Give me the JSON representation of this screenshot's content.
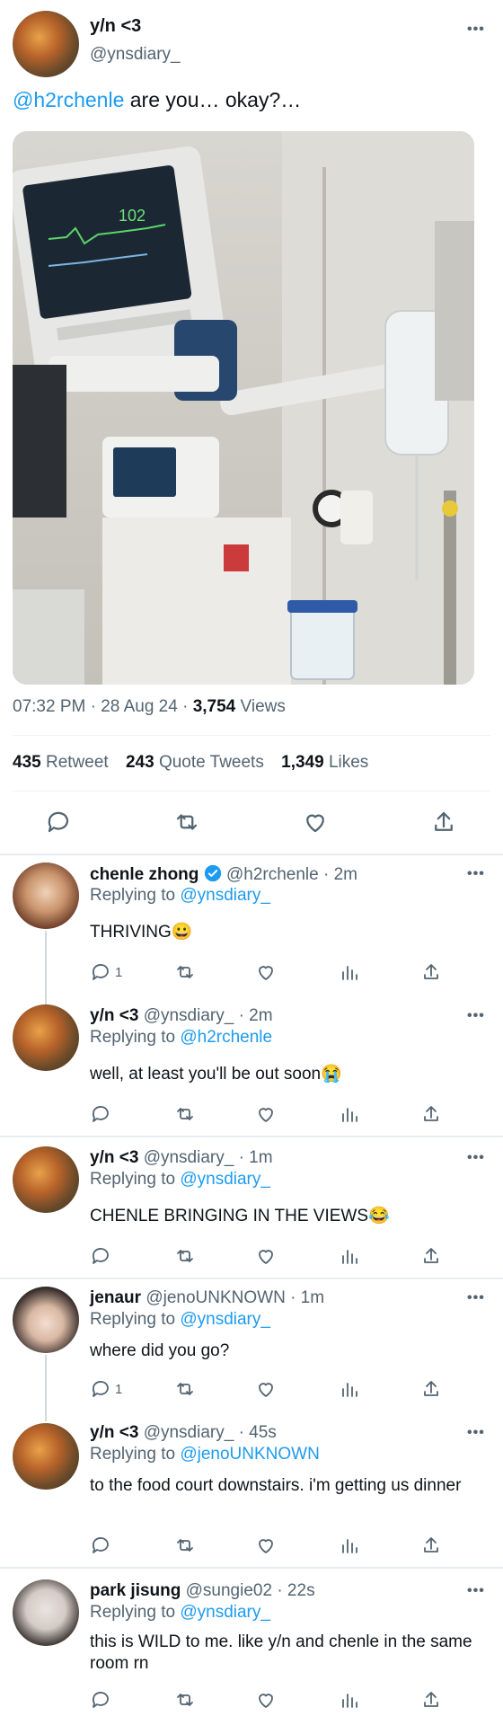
{
  "main_tweet": {
    "display_name": "y/n <3",
    "handle": "@ynsdiary_",
    "mention": "@h2rchenle",
    "text": " are you… okay?…",
    "time": "07:32 PM · 28 Aug 24 · ",
    "views_count": "3,754",
    "views_label": " Views",
    "retweets_count": "435",
    "retweets_label": " Retweet",
    "quotes_count": "243",
    "quotes_label": " Quote Tweets",
    "likes_count": "1,349",
    "likes_label": " Likes"
  },
  "replies": [
    {
      "display_name": "chenle zhong",
      "verified": true,
      "handle_time": "@h2rchenle · 2m",
      "replying_prefix": "Replying to ",
      "replying_to": "@ynsdiary_",
      "text": "THRIVING😀",
      "reply_count": "1"
    },
    {
      "display_name": "y/n <3",
      "handle_time": "@ynsdiary_ · 2m",
      "replying_prefix": "Replying to ",
      "replying_to": "@h2rchenle",
      "text": "well, at least you'll be out soon😭",
      "reply_count": ""
    },
    {
      "display_name": "y/n <3",
      "handle_time": "@ynsdiary_ · 1m",
      "replying_prefix": "Replying to ",
      "replying_to": "@ynsdiary_",
      "text": "CHENLE BRINGING IN THE VIEWS😂",
      "reply_count": ""
    },
    {
      "display_name": "jenaur",
      "handle_time": "@jenoUNKNOWN · 1m",
      "replying_prefix": "Replying to ",
      "replying_to": "@ynsdiary_",
      "text": "where did you go?",
      "reply_count": "1"
    },
    {
      "display_name": "y/n <3",
      "handle_time": "@ynsdiary_ · 45s",
      "replying_prefix": "Replying to ",
      "replying_to": "@jenoUNKNOWN",
      "text": "to the food court downstairs. i'm getting us dinner",
      "reply_count": ""
    },
    {
      "display_name": "park jisung",
      "handle_time": "@sungie02 · 22s",
      "replying_prefix": "Replying to ",
      "replying_to": "@ynsdiary_",
      "text": "this is WILD to me. like y/n and chenle in the same room rn",
      "reply_count": ""
    }
  ],
  "icons": {
    "more": "more-horizontal-icon",
    "reply": "reply-icon",
    "retweet": "retweet-icon",
    "like": "heart-icon",
    "analytics": "analytics-icon",
    "share": "share-icon",
    "verified": "verified-badge-icon"
  },
  "colors": {
    "link": "#1d9bf0",
    "muted": "#536471",
    "verified": "#1d9bf0"
  }
}
